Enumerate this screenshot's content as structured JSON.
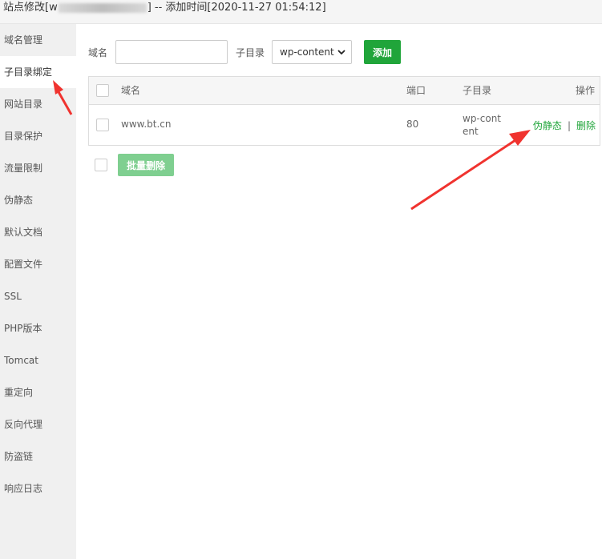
{
  "titlebar": {
    "prefix": "站点修改[",
    "domain_visible": "w",
    "suffix": "] -- 添加时间[2020-11-27 01:54:12]"
  },
  "sidebar": {
    "items": [
      {
        "label": "域名管理"
      },
      {
        "label": "子目录绑定",
        "active": true
      },
      {
        "label": "网站目录"
      },
      {
        "label": "目录保护"
      },
      {
        "label": "流量限制"
      },
      {
        "label": "伪静态"
      },
      {
        "label": "默认文档"
      },
      {
        "label": "配置文件"
      },
      {
        "label": "SSL"
      },
      {
        "label": "PHP版本"
      },
      {
        "label": "Tomcat"
      },
      {
        "label": "重定向"
      },
      {
        "label": "反向代理"
      },
      {
        "label": "防盗链"
      },
      {
        "label": "响应日志"
      }
    ]
  },
  "form": {
    "domain_label": "域名",
    "domain_value": "",
    "subdir_label": "子目录",
    "subdir_selected": "wp-content",
    "add_button": "添加"
  },
  "table": {
    "headers": {
      "domain": "域名",
      "port": "端口",
      "subdir": "子目录",
      "ops": "操作"
    },
    "rows": [
      {
        "domain": "www.bt.cn",
        "port": "80",
        "subdir": "wp-content",
        "op_rewrite": "伪静态",
        "op_sep": "|",
        "op_delete": "删除"
      }
    ]
  },
  "batch": {
    "delete_button": "批量删除"
  },
  "colors": {
    "accent": "#20a53a",
    "annotation_arrow": "#f0332f"
  }
}
